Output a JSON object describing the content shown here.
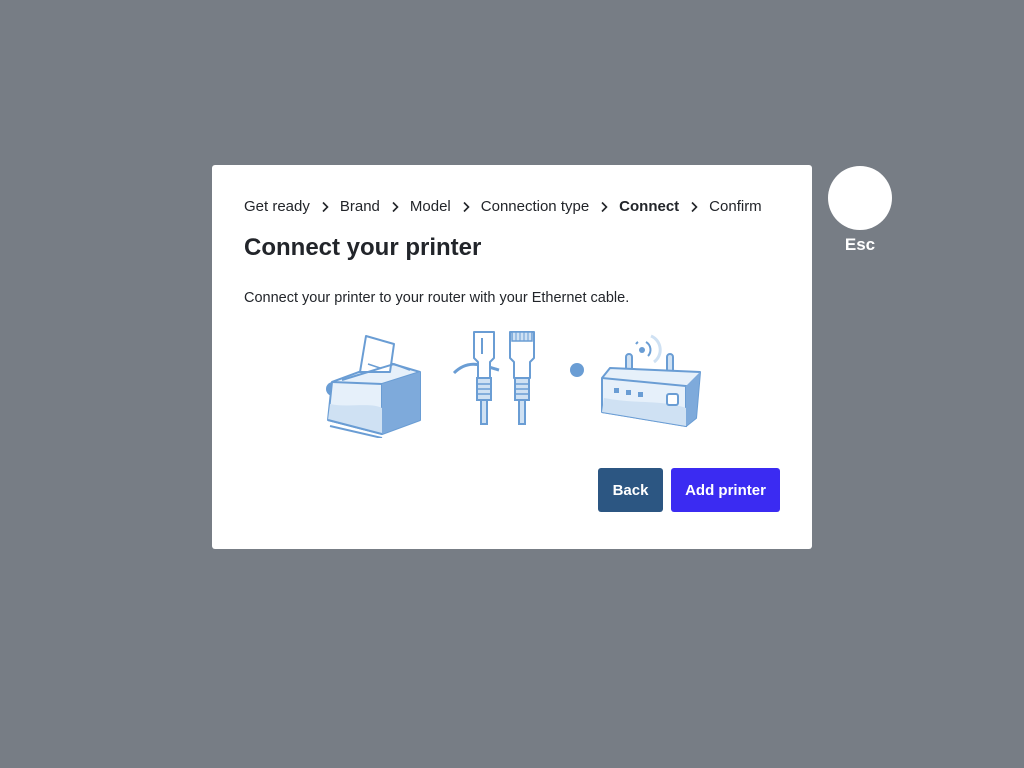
{
  "breadcrumb": {
    "items": [
      {
        "label": "Get ready"
      },
      {
        "label": "Brand"
      },
      {
        "label": "Model"
      },
      {
        "label": "Connection type"
      },
      {
        "label": "Connect",
        "active": true
      },
      {
        "label": "Confirm"
      }
    ],
    "separator_icon": "chevron-right-icon"
  },
  "dialog": {
    "title": "Connect your printer",
    "description": "Connect your printer to your router with your Ethernet cable.",
    "illustration_icon": "printer-ethernet-router-illustration"
  },
  "buttons": {
    "back_label": "Back",
    "add_label": "Add printer"
  },
  "esc": {
    "label": "Esc",
    "icon": "close-circle-icon"
  },
  "colors": {
    "overlay": "#777d85",
    "primary": "#3b2bf2",
    "secondary": "#2c5682",
    "illustration_stroke": "#6a9dd4",
    "illustration_fill": "#cfe1f3"
  }
}
